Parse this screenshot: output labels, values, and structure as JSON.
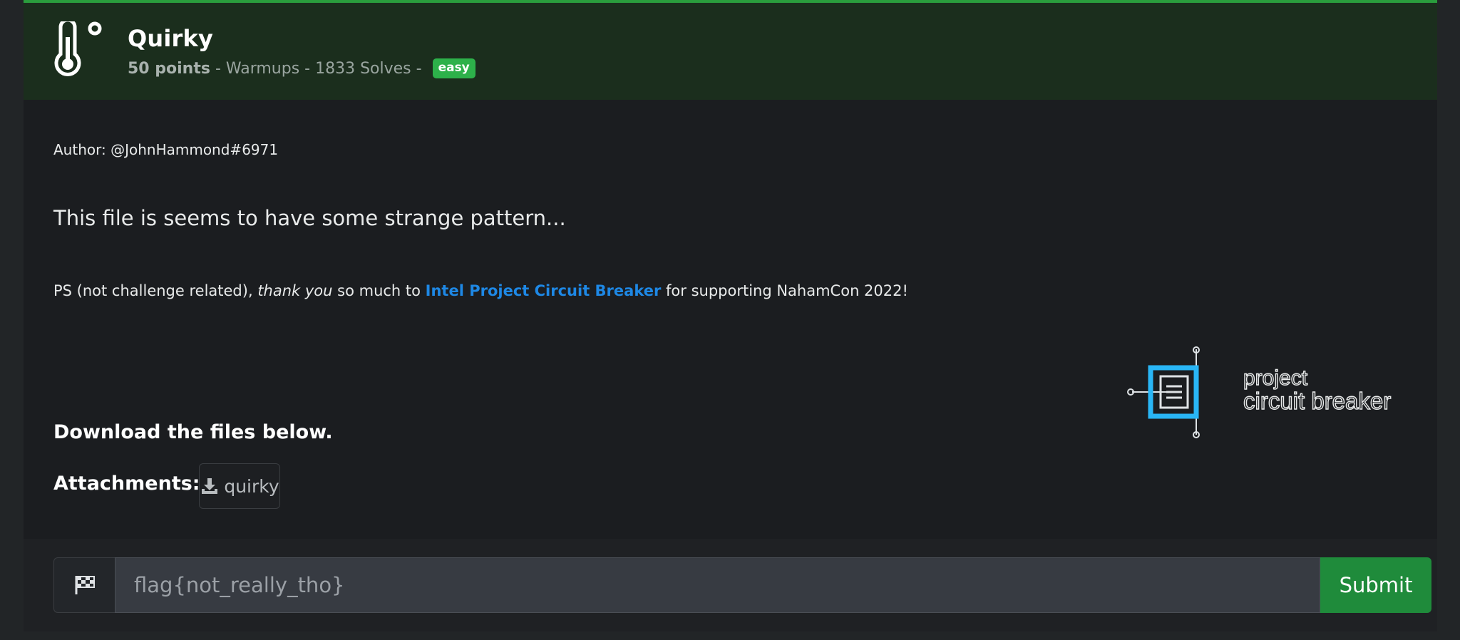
{
  "challenge": {
    "title": "Quirky",
    "points": "50 points",
    "meta_rest": " - Warmups - 1833 Solves - ",
    "difficulty": "easy",
    "icon": "thermometer-icon"
  },
  "body": {
    "author": "Author: @JohnHammond#6971",
    "description": "This file is seems to have some strange pattern...",
    "ps_prefix": "PS (not challenge related), ",
    "ps_em": "thank you",
    "ps_mid": " so much to ",
    "ps_link": "Intel Project Circuit Breaker",
    "ps_suffix": " for supporting NahamCon 2022!",
    "logo_line1": "project",
    "logo_line2": "circuit breaker",
    "download_text": "Download the files below.",
    "attachments_label": "Attachments:",
    "attachment_name": "quirky"
  },
  "submit_form": {
    "flag_placeholder": "flag{not_really_tho}",
    "submit_label": "Submit",
    "flag_icon": "checkered-flag-icon"
  },
  "colors": {
    "header_bg": "#1b2e1d",
    "accent_green": "#2a9d3d",
    "link_blue": "#1e88e5",
    "logo_cyan": "#29b6f6"
  }
}
